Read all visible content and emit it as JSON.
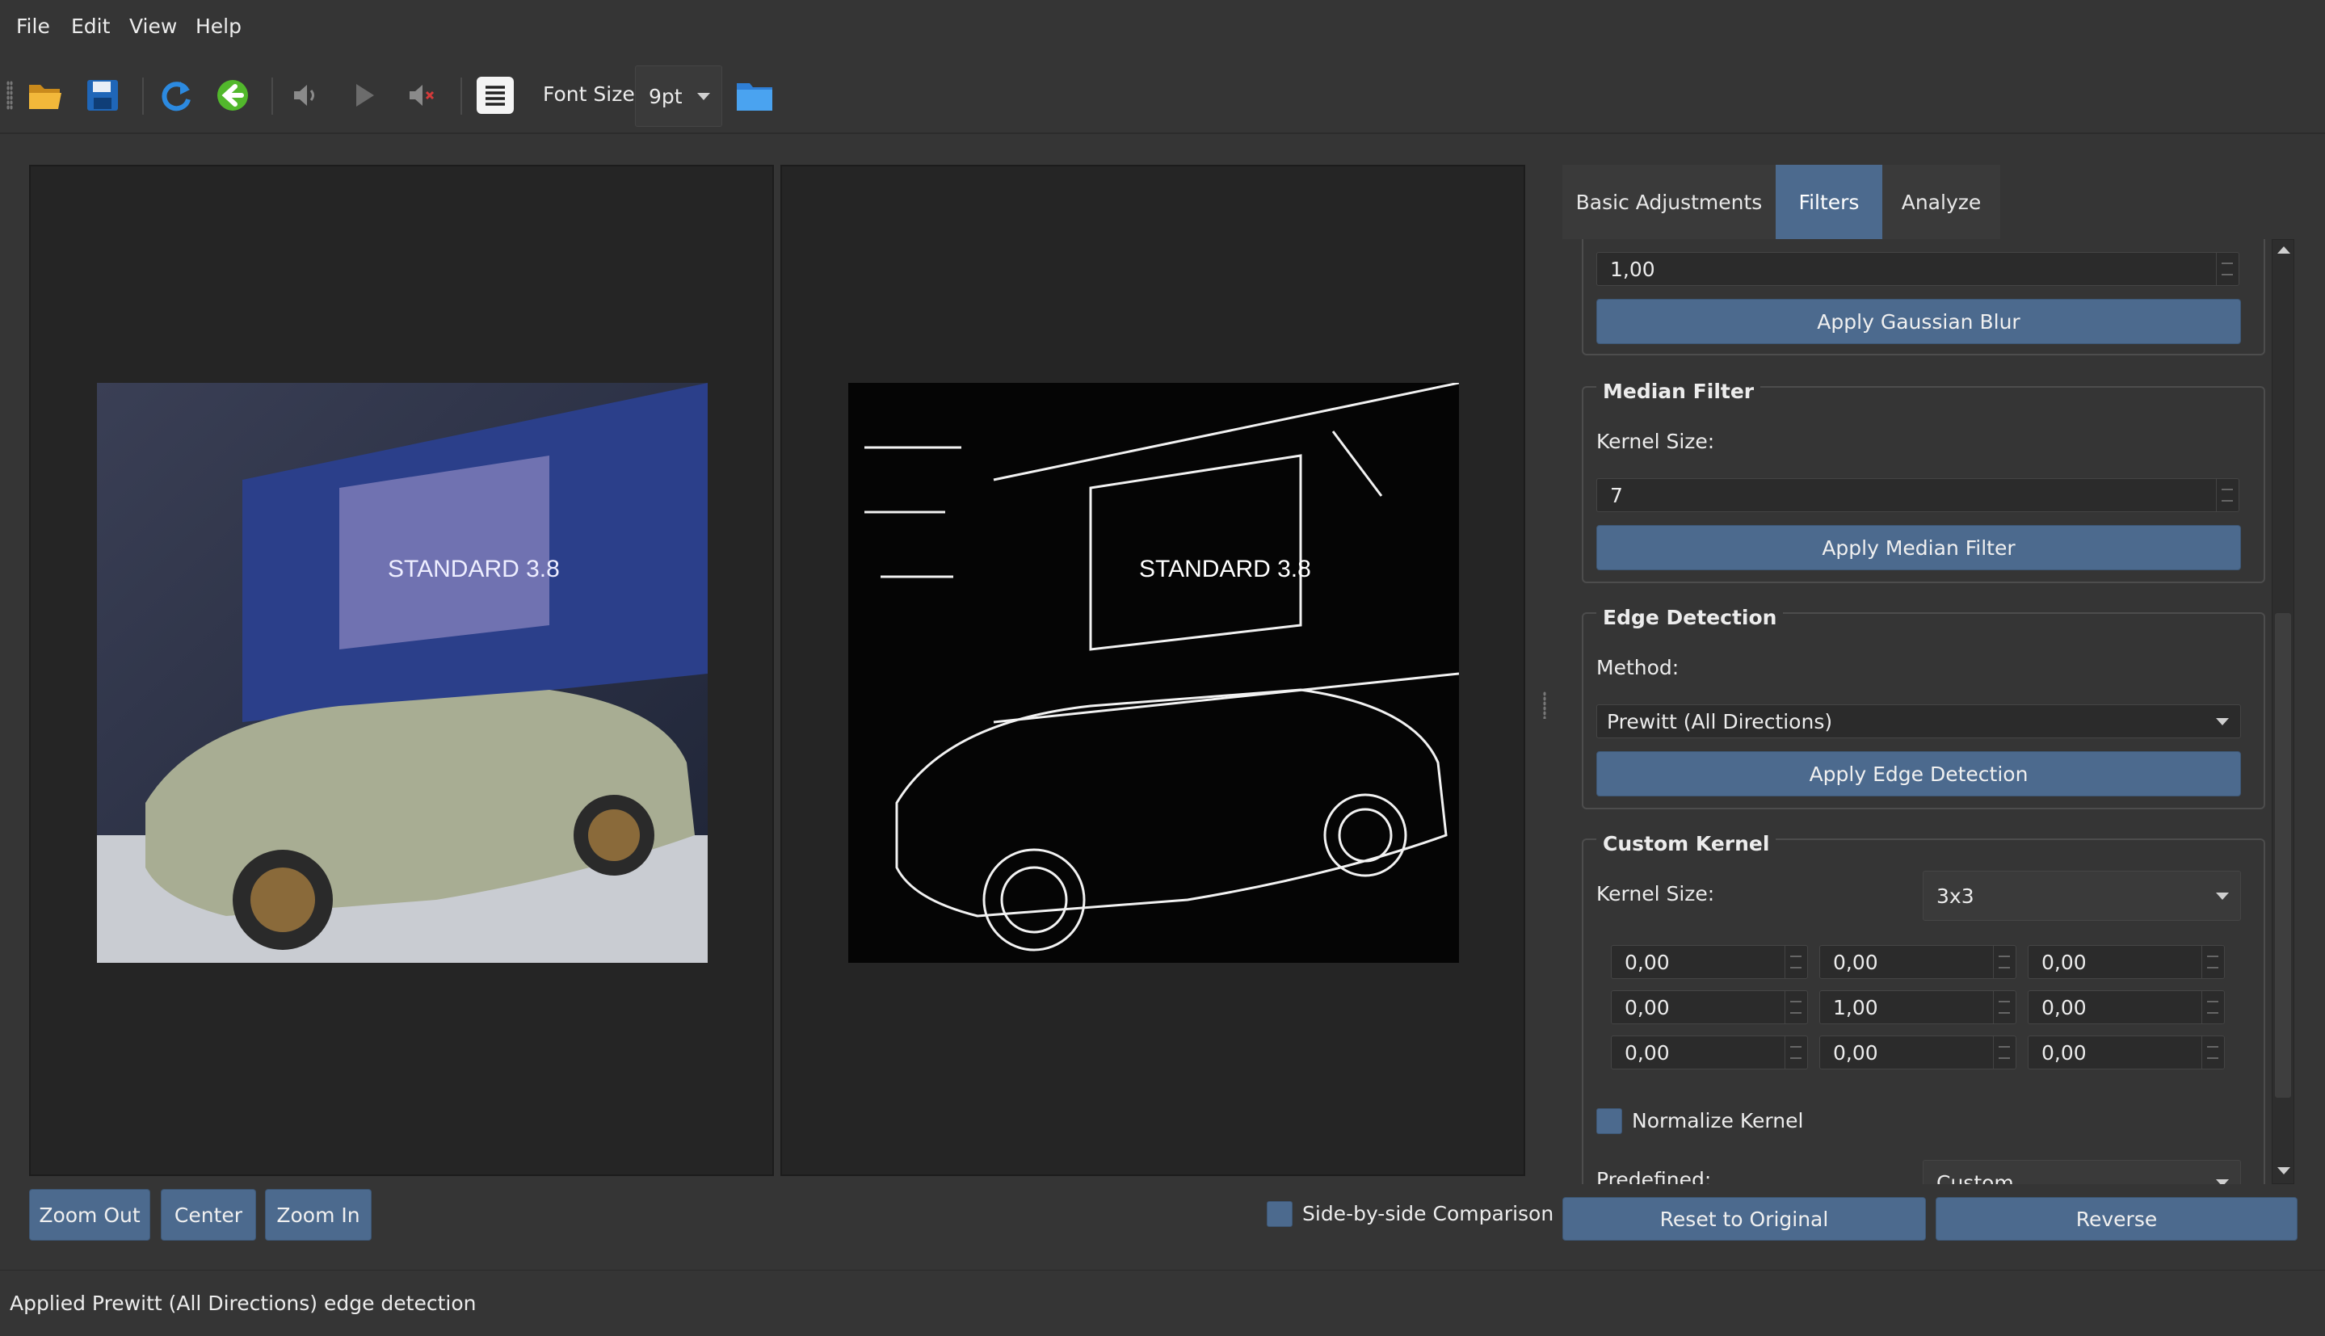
{
  "menu": [
    "File",
    "Edit",
    "View",
    "Help"
  ],
  "toolbar": {
    "font_size_label": "Font Size:",
    "font_size_value": "9pt",
    "icons": [
      "open-folder-icon",
      "save-icon",
      "refresh-icon",
      "back-arrow-icon",
      "volume-icon",
      "play-icon",
      "mute-icon",
      "text-view-icon",
      "folder-browse-icon"
    ]
  },
  "view_controls": {
    "zoom_out": "Zoom Out",
    "center": "Center",
    "zoom_in": "Zoom In",
    "side_by_side": "Side-by-side Comparison",
    "side_by_side_checked": true
  },
  "tabs": [
    "Basic Adjustments",
    "Filters",
    "Analyze"
  ],
  "active_tab": "Filters",
  "filters": {
    "gaussian": {
      "value": "1,00",
      "button": "Apply Gaussian Blur"
    },
    "median": {
      "title": "Median Filter",
      "kernel_label": "Kernel Size:",
      "kernel_value": "7",
      "button": "Apply Median Filter"
    },
    "edge": {
      "title": "Edge Detection",
      "method_label": "Method:",
      "method_value": "Prewitt (All Directions)",
      "button": "Apply Edge Detection"
    },
    "custom": {
      "title": "Custom Kernel",
      "kernel_label": "Kernel Size:",
      "kernel_value": "3x3",
      "matrix": [
        [
          "0,00",
          "0,00",
          "0,00"
        ],
        [
          "0,00",
          "1,00",
          "0,00"
        ],
        [
          "0,00",
          "0,00",
          "0,00"
        ]
      ],
      "normalize_label": "Normalize Kernel",
      "normalize_checked": true,
      "predefined_label": "Predefined:",
      "predefined_value": "Custom"
    }
  },
  "actions": {
    "reset": "Reset to Original",
    "reverse": "Reverse"
  },
  "status": "Applied Prewitt (All Directions) edge detection",
  "colors": {
    "accent": "#4c6a8e",
    "background": "#353535",
    "pane": "#252525"
  }
}
